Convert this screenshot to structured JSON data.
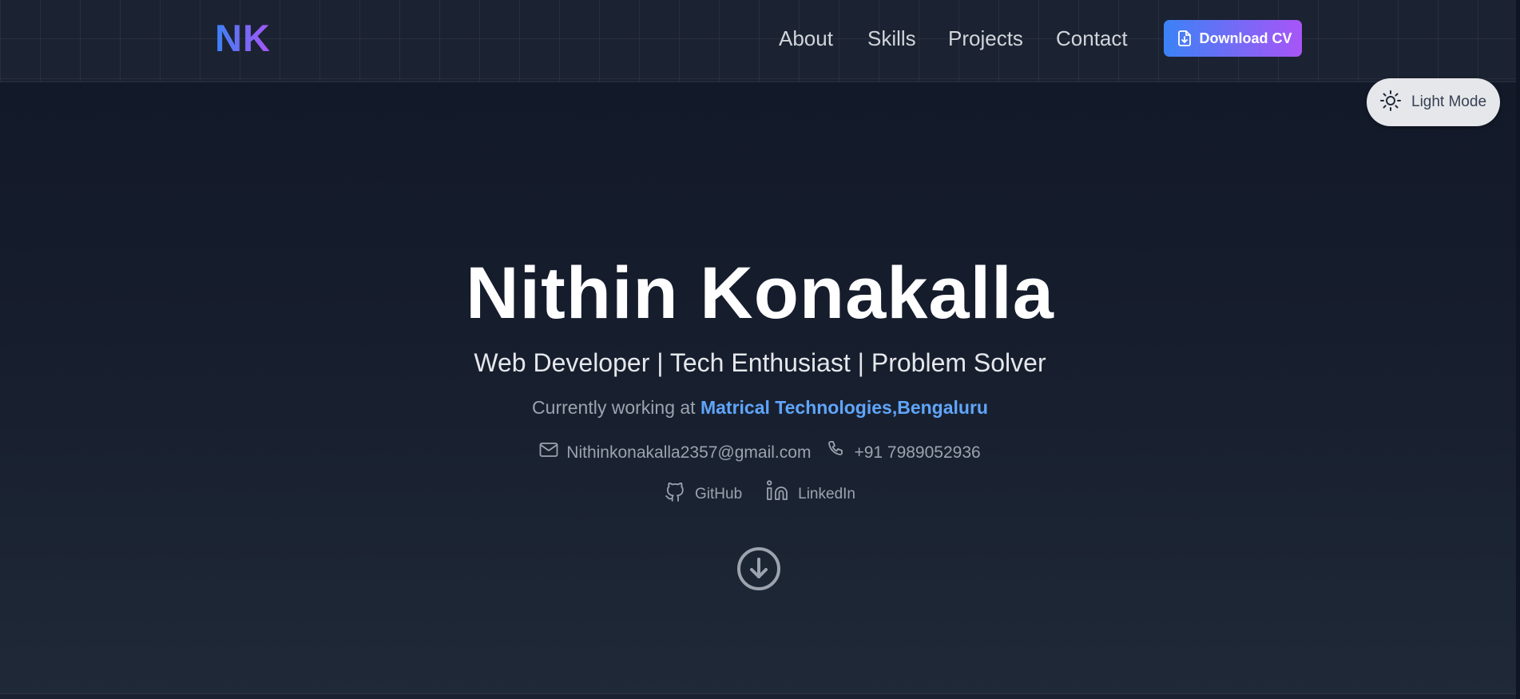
{
  "nav": {
    "logo": "NK",
    "links": [
      "About",
      "Skills",
      "Projects",
      "Contact"
    ],
    "download_cv": "Download CV",
    "download_icon": "file-download-icon"
  },
  "theme_toggle": {
    "label": "Light Mode",
    "icon": "sun-icon"
  },
  "hero": {
    "name": "Nithin Konakalla",
    "tagline": "Web Developer | Tech Enthusiast | Problem Solver",
    "working_prefix": "Currently working at",
    "company": "Matrical Technologies,Bengaluru",
    "email": "Nithinkonakalla2357@gmail.com",
    "phone": "+91 7989052936",
    "github": "GitHub",
    "linkedin": "LinkedIn"
  },
  "colors": {
    "accent_start": "#3b82f6",
    "accent_end": "#a855f7",
    "company_link": "#60a5fa",
    "background": "#111827"
  }
}
